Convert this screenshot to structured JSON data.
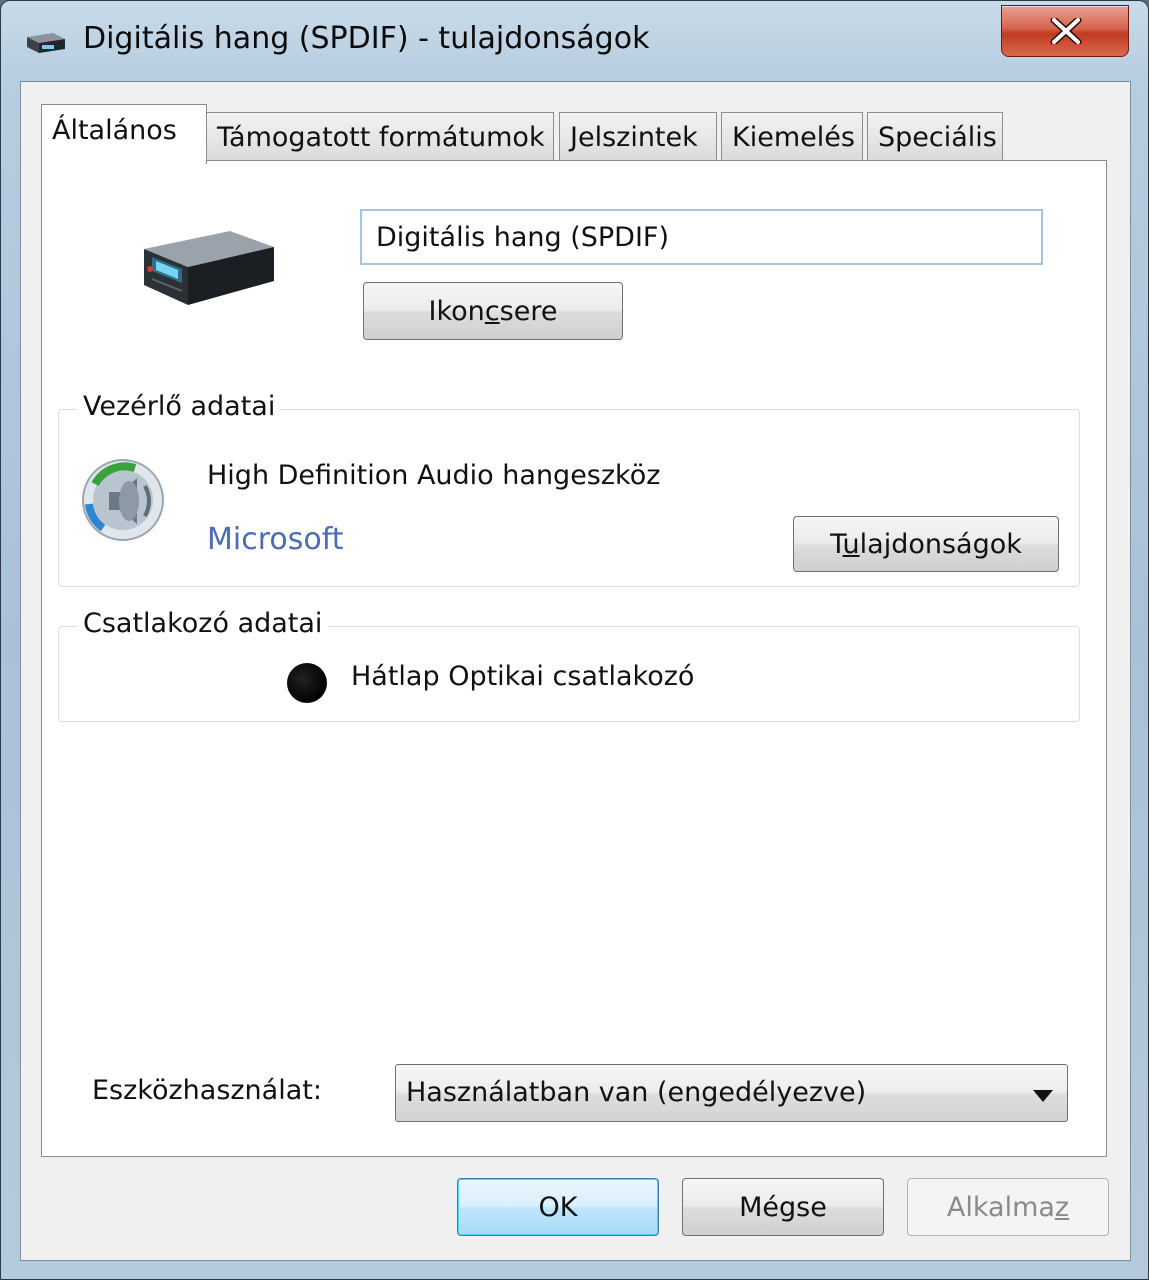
{
  "window": {
    "title": "Digitális hang (SPDIF) - tulajdonságok",
    "close_label": "×"
  },
  "tabs": [
    {
      "label": "Általános",
      "active": true
    },
    {
      "label": "Támogatott formátumok",
      "active": false
    },
    {
      "label": "Jelszintek",
      "active": false
    },
    {
      "label": "Kiemelés",
      "active": false
    },
    {
      "label": "Speciális",
      "active": false
    }
  ],
  "general": {
    "device_name": "Digitális hang (SPDIF)",
    "change_icon_button": {
      "before": "Ikon",
      "accel": "c",
      "after": "sere"
    }
  },
  "controller": {
    "legend": "Vezérlő adatai",
    "name": "High Definition Audio hangeszköz",
    "vendor": "Microsoft",
    "properties_button": {
      "before": "T",
      "accel": "u",
      "after": "lajdonságok"
    }
  },
  "connector": {
    "legend": "Csatlakozó adatai",
    "jack_color": "#000000",
    "label": "Hátlap Optikai csatlakozó"
  },
  "usage": {
    "label": "Eszközhasználat:",
    "selected": "Használatban van (engedélyezve)"
  },
  "buttons": {
    "ok": "OK",
    "cancel": "Mégse",
    "apply": {
      "before": "Alkalma",
      "accel": "z",
      "after": ""
    }
  },
  "icons": {
    "title": "audio-device-icon",
    "device": "audio-device-icon",
    "controller": "speaker-icon",
    "dropdown": "dropdown-arrow-icon"
  }
}
